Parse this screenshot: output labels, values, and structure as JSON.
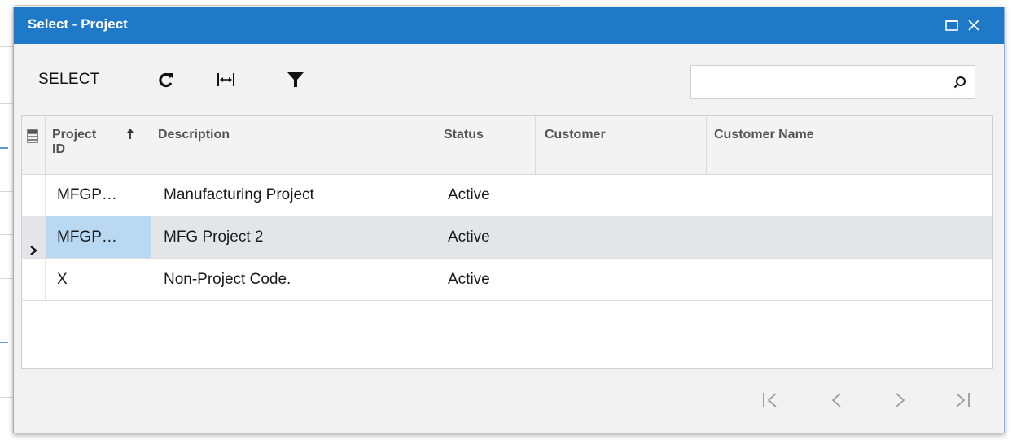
{
  "dialog": {
    "title": "Select - Project"
  },
  "toolbar": {
    "select_label": "SELECT"
  },
  "search": {
    "value": "",
    "placeholder": ""
  },
  "grid": {
    "columns": [
      "Project ID",
      "Description",
      "Status",
      "Customer",
      "Customer Name"
    ],
    "rows": [
      {
        "project_id": "MFGP…",
        "description": "Manufacturing Project",
        "status": "Active",
        "customer": "",
        "customer_name": "",
        "selected": false
      },
      {
        "project_id": "MFGP…",
        "description": "MFG Project 2",
        "status": "Active",
        "customer": "",
        "customer_name": "",
        "selected": true
      },
      {
        "project_id": "X",
        "description": "Non-Project Code.",
        "status": "Active",
        "customer": "",
        "customer_name": "",
        "selected": false
      }
    ]
  },
  "colors": {
    "titlebar": "#1e7ac6",
    "selected_row": "#e3e5e8",
    "selected_cell": "#b9d8f2"
  },
  "icons": [
    "maximize-icon",
    "close-icon",
    "refresh-icon",
    "fit-columns-icon",
    "filter-icon",
    "search-icon",
    "column-settings-icon",
    "sort-ascending-icon",
    "row-chevron-icon",
    "first-page-icon",
    "prev-page-icon",
    "next-page-icon",
    "last-page-icon"
  ]
}
